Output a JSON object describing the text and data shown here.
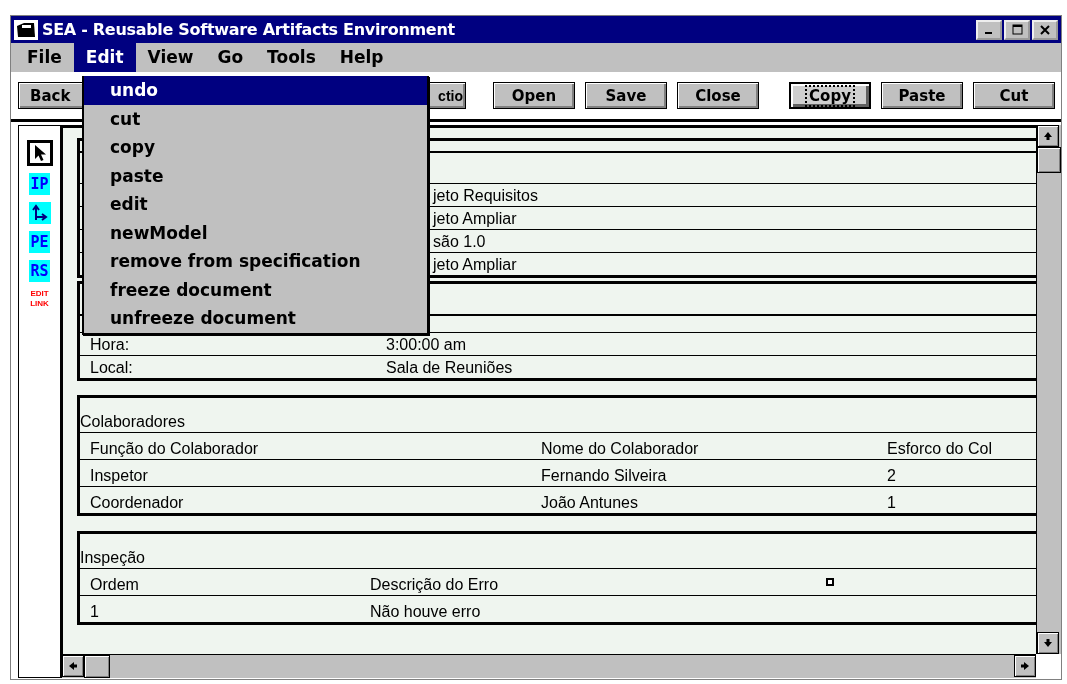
{
  "window": {
    "title": "SEA - Reusable Software Artifacts Environment"
  },
  "menu_bar": [
    {
      "label": "File",
      "selected": false
    },
    {
      "label": "Edit",
      "selected": true
    },
    {
      "label": "View",
      "selected": false
    },
    {
      "label": "Go",
      "selected": false
    },
    {
      "label": "Tools",
      "selected": false
    },
    {
      "label": "Help",
      "selected": false
    }
  ],
  "edit_menu": [
    {
      "label": "undo",
      "selected": true
    },
    {
      "label": "cut",
      "selected": false
    },
    {
      "label": "copy",
      "selected": false
    },
    {
      "label": "paste",
      "selected": false
    },
    {
      "label": "edit",
      "selected": false
    },
    {
      "label": "newModel",
      "selected": false
    },
    {
      "label": "remove from specification",
      "selected": false
    },
    {
      "label": "freeze document",
      "selected": false
    },
    {
      "label": "unfreeze document",
      "selected": false
    }
  ],
  "toolbar": [
    [
      {
        "label": "Back",
        "focused": false
      }
    ],
    [
      {
        "label": "ctio",
        "focused": false
      }
    ],
    [
      {
        "label": "Open",
        "focused": false
      },
      {
        "label": "Save",
        "focused": false
      },
      {
        "label": "Close",
        "focused": false
      }
    ],
    [
      {
        "label": "Copy",
        "focused": true
      },
      {
        "label": "Paste",
        "focused": false
      },
      {
        "label": "Cut",
        "focused": false
      }
    ]
  ],
  "palette": [
    {
      "kind": "pointer",
      "selected": true
    },
    {
      "kind": "label",
      "label": "IP",
      "selected": false
    },
    {
      "kind": "connector",
      "selected": false
    },
    {
      "kind": "label",
      "label": "PE",
      "selected": false
    },
    {
      "kind": "label",
      "label": "RS",
      "selected": false
    },
    {
      "kind": "link",
      "label": "EDIT LINK",
      "selected": false
    }
  ],
  "sections": [
    {
      "kind": "form",
      "rows": [
        {
          "value": "jeto Requisitos"
        },
        {
          "value": "jeto Ampliar"
        },
        {
          "value": "são 1.0"
        },
        {
          "value": "jeto Ampliar"
        }
      ]
    },
    {
      "kind": "form",
      "rows": [
        {
          "label": "Hora:",
          "value": "3:00:00 am"
        },
        {
          "label": "Local:",
          "value": "Sala de Reuniões"
        }
      ]
    },
    {
      "kind": "table3",
      "title": "Colaboradores",
      "columns": [
        "Função do Colaborador",
        "Nome do Colaborador",
        "Esforco do Col"
      ],
      "rows": [
        [
          "Inspetor",
          "Fernando Silveira",
          "2"
        ],
        [
          "Coordenador",
          "João Antunes",
          "1"
        ]
      ]
    },
    {
      "kind": "table2",
      "title": "Inspeção",
      "columns": [
        "Ordem",
        "Descrição do Erro"
      ],
      "rows": [
        [
          "1",
          "Não houve erro"
        ]
      ]
    }
  ]
}
